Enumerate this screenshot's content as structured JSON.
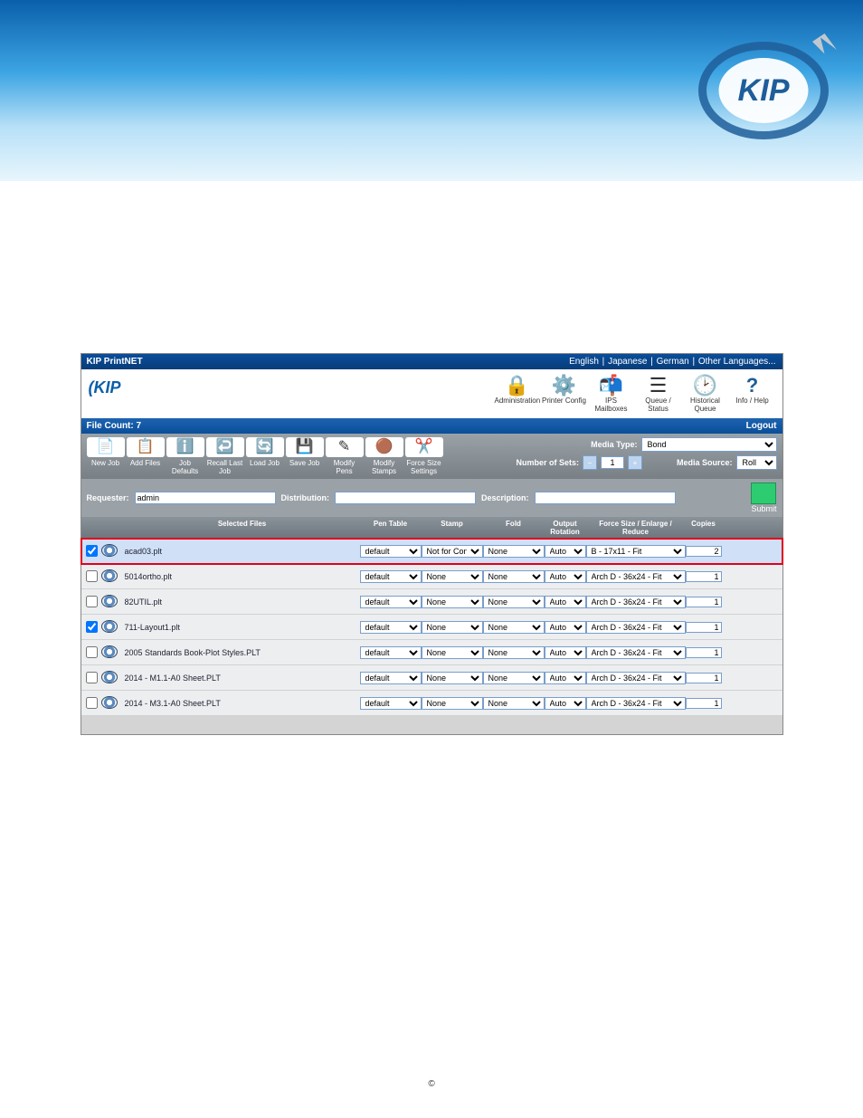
{
  "app_title": "KIP PrintNET",
  "languages": [
    "English",
    "Japanese",
    "German",
    "Other Languages..."
  ],
  "header_icons": [
    {
      "label": "Administration",
      "glyph": "🔒"
    },
    {
      "label": "Printer Config",
      "glyph": "⚙️"
    },
    {
      "label": "IPS Mailboxes",
      "glyph": "📬"
    },
    {
      "label": "Queue / Status",
      "glyph": "☰"
    },
    {
      "label": "Historical Queue",
      "glyph": "🕑"
    },
    {
      "label": "Info / Help",
      "glyph": "?"
    }
  ],
  "file_count_label": "File Count: 7",
  "logout_label": "Logout",
  "toolbar": [
    {
      "label": "New Job",
      "glyph": "📄"
    },
    {
      "label": "Add Files",
      "glyph": "📋"
    },
    {
      "label": "Job Defaults",
      "glyph": "ℹ️"
    },
    {
      "label": "Recall Last Job",
      "glyph": "↩️"
    },
    {
      "label": "Load Job",
      "glyph": "🔄"
    },
    {
      "label": "Save Job",
      "glyph": "💾"
    },
    {
      "label": "Modify Pens",
      "glyph": "✎"
    },
    {
      "label": "Modify Stamps",
      "glyph": "🟤"
    },
    {
      "label": "Force Size Settings",
      "glyph": "✂️"
    }
  ],
  "media_type_label": "Media Type:",
  "media_type_value": "Bond",
  "number_of_sets_label": "Number of Sets:",
  "number_of_sets_value": "1",
  "media_source_label": "Media Source:",
  "media_source_value": "Roll",
  "requester_label": "Requester:",
  "requester_value": "admin",
  "distribution_label": "Distribution:",
  "distribution_value": "",
  "description_label": "Description:",
  "description_value": "",
  "submit_label": "Submit",
  "columns": {
    "selected_files": "Selected Files",
    "pen_table": "Pen Table",
    "stamp": "Stamp",
    "fold": "Fold",
    "output_rotation": "Output Rotation",
    "force_size": "Force Size / Enlarge / Reduce",
    "copies": "Copies"
  },
  "rows": [
    {
      "checked": true,
      "highlight": true,
      "file": "acad03.plt",
      "pen": "default",
      "stamp": "Not for Constructio",
      "fold": "None",
      "rotation": "Auto",
      "size": "B - 17x11 - Fit",
      "copies": "2"
    },
    {
      "checked": false,
      "highlight": false,
      "file": "5014ortho.plt",
      "pen": "default",
      "stamp": "None",
      "fold": "None",
      "rotation": "Auto",
      "size": "Arch D - 36x24 - Fit",
      "copies": "1"
    },
    {
      "checked": false,
      "highlight": false,
      "file": "82UTIL.plt",
      "pen": "default",
      "stamp": "None",
      "fold": "None",
      "rotation": "Auto",
      "size": "Arch D - 36x24 - Fit",
      "copies": "1"
    },
    {
      "checked": true,
      "highlight": false,
      "file": "711-Layout1.plt",
      "pen": "default",
      "stamp": "None",
      "fold": "None",
      "rotation": "Auto",
      "size": "Arch D - 36x24 - Fit",
      "copies": "1"
    },
    {
      "checked": false,
      "highlight": false,
      "file": "2005 Standards Book-Plot Styles.PLT",
      "pen": "default",
      "stamp": "None",
      "fold": "None",
      "rotation": "Auto",
      "size": "Arch D - 36x24 - Fit",
      "copies": "1"
    },
    {
      "checked": false,
      "highlight": false,
      "file": "2014 - M1.1-A0 Sheet.PLT",
      "pen": "default",
      "stamp": "None",
      "fold": "None",
      "rotation": "Auto",
      "size": "Arch D - 36x24 - Fit",
      "copies": "1"
    },
    {
      "checked": false,
      "highlight": false,
      "file": "2014 - M3.1-A0 Sheet.PLT",
      "pen": "default",
      "stamp": "None",
      "fold": "None",
      "rotation": "Auto",
      "size": "Arch D - 36x24 - Fit",
      "copies": "1"
    }
  ],
  "copyright": "©"
}
